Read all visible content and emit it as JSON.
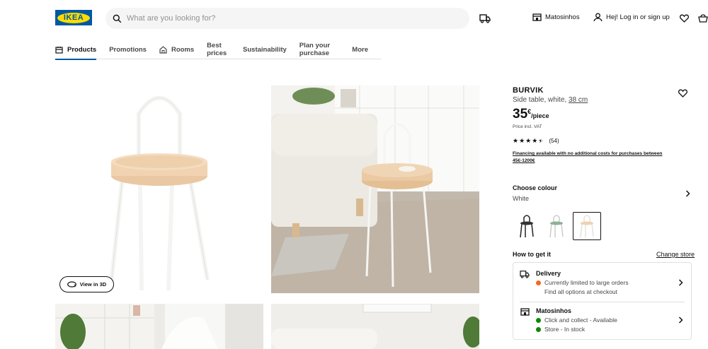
{
  "header": {
    "logo_text": "IKEA",
    "search_placeholder": "What are you looking for?",
    "store_label": "Matosinhos",
    "login_label": "Hej! Log in or sign up"
  },
  "nav": {
    "tabs": [
      {
        "label": "Products",
        "icon": "products-icon",
        "active": true
      },
      {
        "label": "Promotions"
      },
      {
        "label": "Rooms",
        "icon": "rooms-icon"
      },
      {
        "label": "Best prices"
      },
      {
        "label": "Sustainability"
      },
      {
        "label": "Plan your purchase"
      },
      {
        "label": "More"
      }
    ]
  },
  "gallery": {
    "view_3d_label": "View in 3D"
  },
  "product": {
    "name": "BURVIK",
    "description": "Side table, white,",
    "size": "38 cm",
    "price_int": "35",
    "price_currency": "€",
    "price_unit": "/piece",
    "vat_note": "Price incl. VAT",
    "rating": 4.5,
    "review_count": "(54)",
    "financing": "Financing available with no additional costs for purchases between 45€-1200€"
  },
  "colour": {
    "title": "Choose colour",
    "selected": "White",
    "swatches": [
      "black",
      "green",
      "white"
    ]
  },
  "fulfilment": {
    "title": "How to get it",
    "change_store": "Change store",
    "delivery": {
      "title": "Delivery",
      "status": "Currently limited to large orders",
      "status_color": "#f26a21",
      "note": "Find all options at checkout"
    },
    "store": {
      "title": "Matosinhos",
      "line1": "Click and collect - Available",
      "line2": "Store - In stock",
      "status_color": "#0a8a00"
    }
  },
  "colors": {
    "brand_blue": "#0058a3",
    "brand_yellow": "#ffdb00"
  }
}
